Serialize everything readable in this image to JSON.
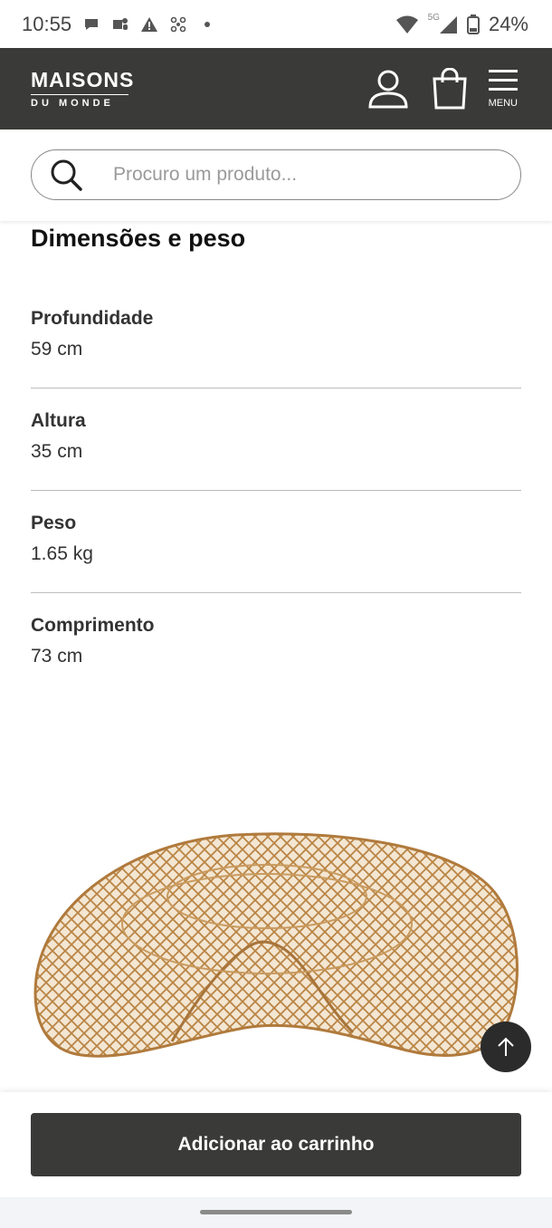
{
  "status_bar": {
    "time": "10:55",
    "network": "5G",
    "battery": "24%"
  },
  "header": {
    "logo_main": "MAISONS",
    "logo_sub": "DU MONDE",
    "menu_label": "MENU"
  },
  "search": {
    "placeholder": "Procuro um produto..."
  },
  "dimensions": {
    "title": "Dimensões e peso",
    "items": [
      {
        "label": "Profundidade",
        "value": "59 cm"
      },
      {
        "label": "Altura",
        "value": "35 cm"
      },
      {
        "label": "Peso",
        "value": "1.65 kg"
      },
      {
        "label": "Comprimento",
        "value": "73 cm"
      }
    ]
  },
  "actions": {
    "add_to_cart": "Adicionar ao carrinho"
  },
  "colors": {
    "header_bg": "#3a3a38",
    "button_bg": "#3a3a38",
    "rattan": "#c99a5e"
  }
}
